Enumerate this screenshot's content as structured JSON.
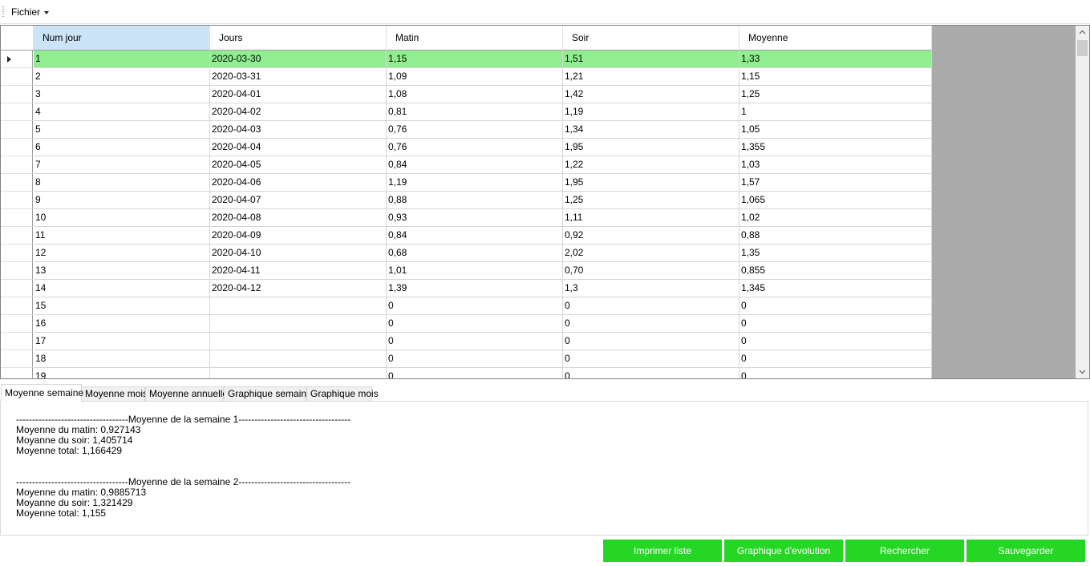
{
  "menu": {
    "file_label": "Fichier"
  },
  "grid": {
    "columns": [
      "Num jour",
      "Jours",
      "Matin",
      "Soir",
      "Moyenne"
    ],
    "rows": [
      [
        "1",
        "2020-03-30",
        "1,15",
        "1,51",
        "1,33"
      ],
      [
        "2",
        "2020-03-31",
        "1,09",
        "1,21",
        "1,15"
      ],
      [
        "3",
        "2020-04-01",
        "1,08",
        "1,42",
        "1,25"
      ],
      [
        "4",
        "2020-04-02",
        "0,81",
        "1,19",
        "1"
      ],
      [
        "5",
        "2020-04-03",
        "0,76",
        "1,34",
        "1,05"
      ],
      [
        "6",
        "2020-04-04",
        "0,76",
        "1,95",
        "1,355"
      ],
      [
        "7",
        "2020-04-05",
        "0,84",
        "1,22",
        "1,03"
      ],
      [
        "8",
        "2020-04-06",
        "1,19",
        "1,95",
        "1,57"
      ],
      [
        "9",
        "2020-04-07",
        "0,88",
        "1,25",
        "1,065"
      ],
      [
        "10",
        "2020-04-08",
        "0,93",
        "1,11",
        "1,02"
      ],
      [
        "11",
        "2020-04-09",
        "0,84",
        "0,92",
        "0,88"
      ],
      [
        "12",
        "2020-04-10",
        "0,68",
        "2,02",
        "1,35"
      ],
      [
        "13",
        "2020-04-11",
        "1,01",
        "0,70",
        "0,855"
      ],
      [
        "14",
        "2020-04-12",
        "1,39",
        "1,3",
        "1,345"
      ],
      [
        "15",
        "",
        "0",
        "0",
        "0"
      ],
      [
        "16",
        "",
        "0",
        "0",
        "0"
      ],
      [
        "17",
        "",
        "0",
        "0",
        "0"
      ],
      [
        "18",
        "",
        "0",
        "0",
        "0"
      ],
      [
        "19",
        "",
        "0",
        "0",
        "0"
      ]
    ],
    "selected_row_color": "#90ee90",
    "selected_header_color": "#cce4f7"
  },
  "tabs": [
    "Moyenne semaine",
    "Moyenne mois",
    "Moyenne annuelle",
    "Graphique semaine",
    "Graphique mois"
  ],
  "active_tab": "Moyenne semaine",
  "panel": {
    "week1": {
      "title": "-----------------------------------Moyenne de la semaine 1-----------------------------------",
      "matin": "Moyenne du matin: 0,927143",
      "soir": "Moyanne du soir: 1,405714",
      "total": "Moyenne total: 1,166429"
    },
    "week2": {
      "title": "-----------------------------------Moyenne de la semaine 2-----------------------------------",
      "matin": "Moyenne du matin: 0,9885713",
      "soir": "Moyanne du soir: 1,321429",
      "total": "Moyenne total: 1,155"
    }
  },
  "buttons": {
    "print": "Imprimer liste",
    "chart": "Graphique d'evolution",
    "search": "Rechercher",
    "save": "Sauvegarder",
    "color": "#25d625"
  }
}
